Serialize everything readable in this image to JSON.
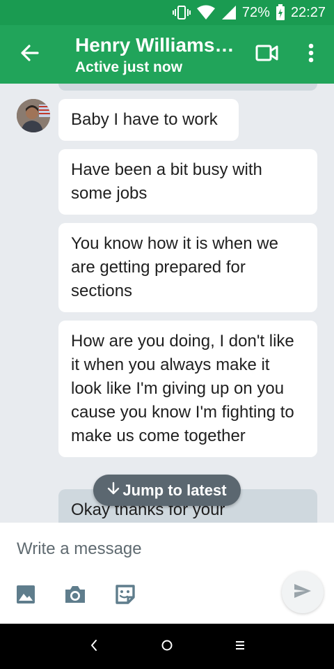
{
  "status_bar": {
    "battery": "72%",
    "time": "22:27",
    "icons": [
      "vibrate-icon",
      "wifi-icon",
      "signal-icon",
      "battery-icon"
    ]
  },
  "header": {
    "contact_name": "Henry Williams…",
    "status": "Active just now",
    "icons": [
      "back-arrow-icon",
      "video-call-icon",
      "more-vert-icon"
    ],
    "color": "#21a45a"
  },
  "messages": [
    {
      "text": "Baby I have to work",
      "direction": "received"
    },
    {
      "text": "Have been a bit busy with some jobs",
      "direction": "received"
    },
    {
      "text": "You know how it is when we are getting prepared for sections",
      "direction": "received"
    },
    {
      "text": "How are you doing, I don't like it when you always make it look like I'm giving up on you cause you know I'm fighting to make us come together",
      "direction": "received"
    },
    {
      "text": "Okay thanks for your",
      "direction": "sent"
    }
  ],
  "jump_to_latest": "Jump to latest",
  "composer": {
    "placeholder": "Write a message",
    "tools": [
      "gallery-icon",
      "camera-icon",
      "sticker-icon"
    ],
    "send_icon": "send-icon"
  },
  "nav_bar": {
    "buttons": [
      "back-nav-icon",
      "home-nav-icon",
      "recents-nav-icon"
    ]
  }
}
